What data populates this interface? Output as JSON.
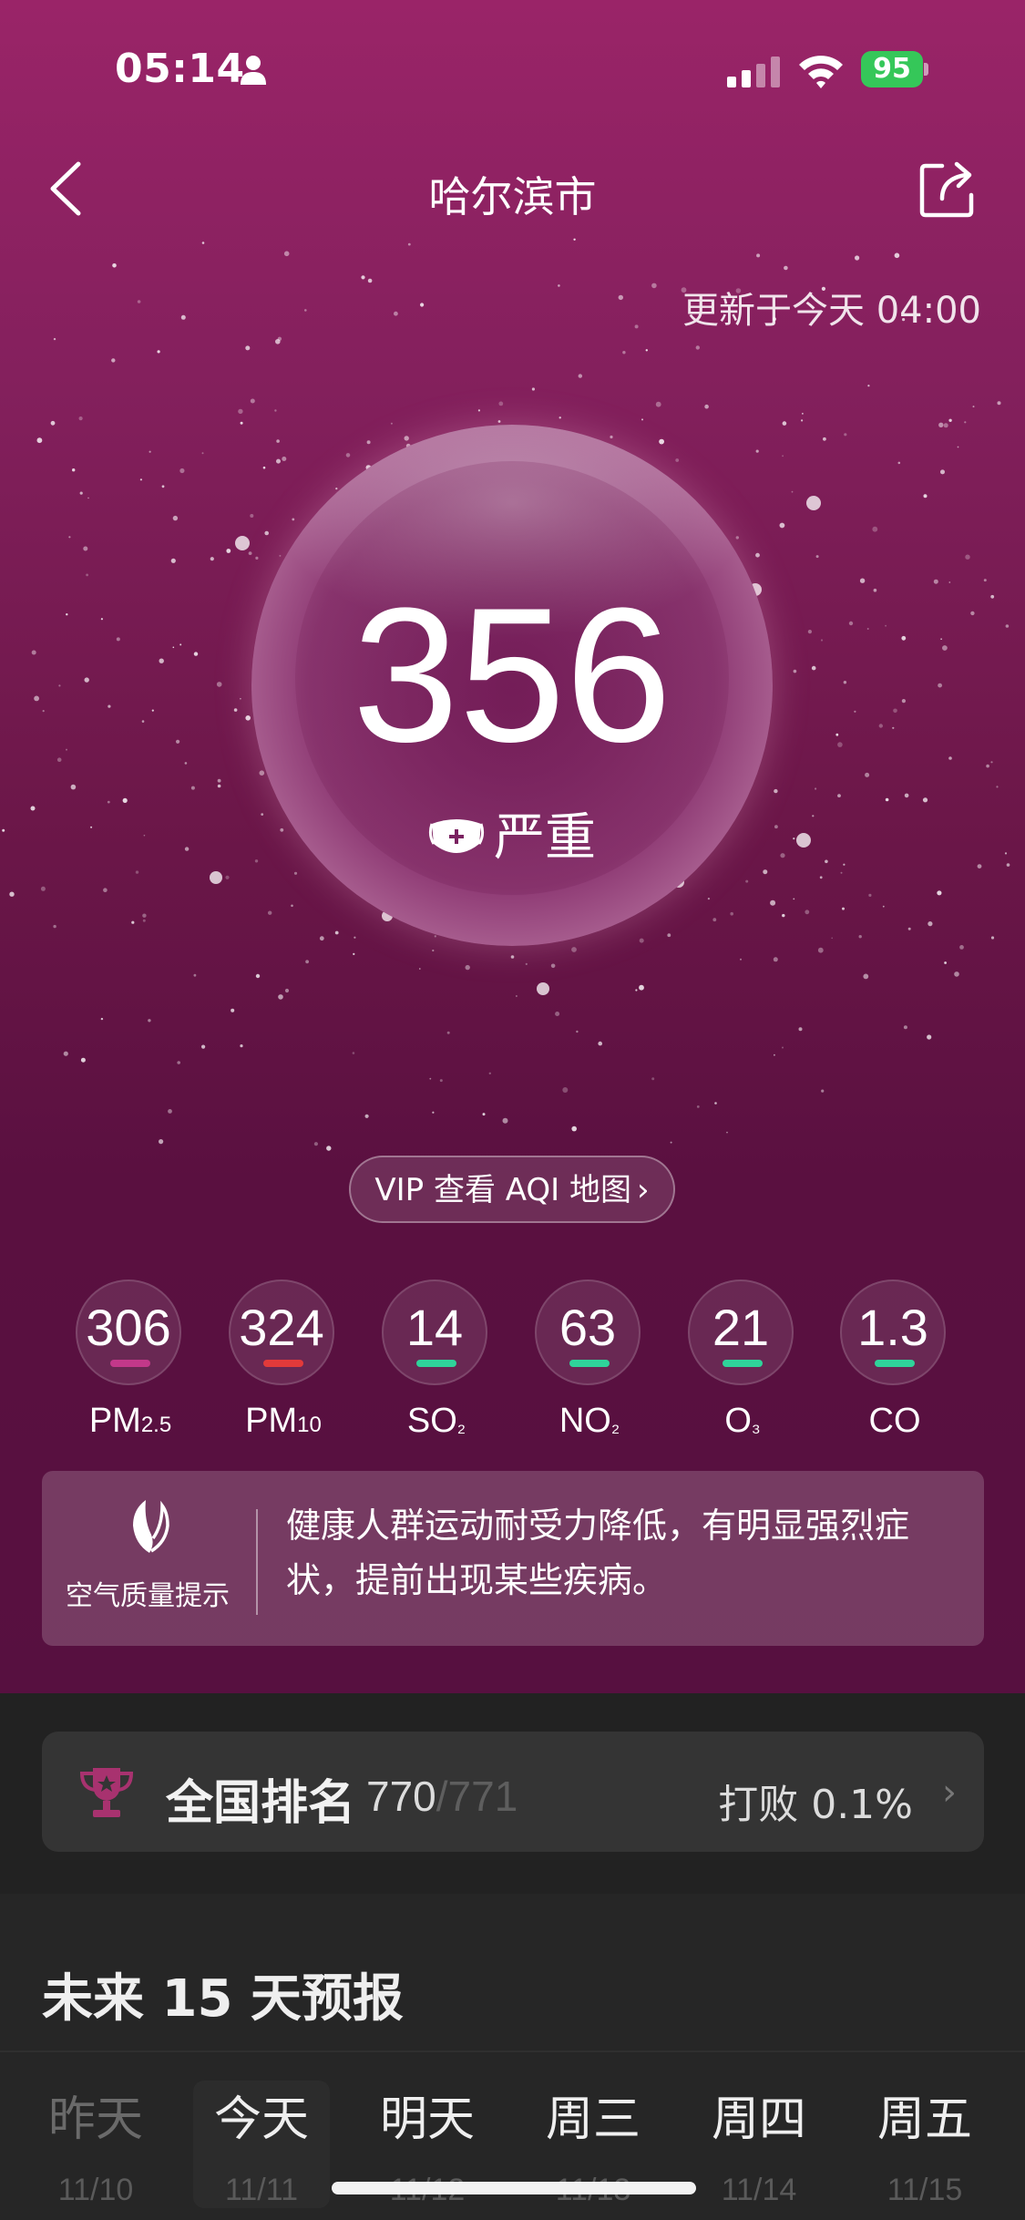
{
  "status_bar": {
    "time": "05:14",
    "battery": "95",
    "icons": [
      "person-icon",
      "signal-icon",
      "wifi-icon",
      "battery-charging-icon"
    ]
  },
  "nav": {
    "title": "哈尔滨市",
    "back_icon": "chevron-left-icon",
    "share_icon": "share-icon"
  },
  "updated": "更新于今天 04:00",
  "aqi": {
    "value": "356",
    "level": "严重",
    "level_icon": "mask-icon"
  },
  "vip_button": {
    "label": "VIP 查看 AQI 地图",
    "chevron": "›"
  },
  "pollutants": [
    {
      "value": "306",
      "name": "PM",
      "sub": "2.5",
      "color": "#c2388a"
    },
    {
      "value": "324",
      "name": "PM",
      "sub": "10",
      "color": "#e23a3a"
    },
    {
      "value": "14",
      "name": "SO",
      "sub": "₂",
      "color": "#2fd39a"
    },
    {
      "value": "63",
      "name": "NO",
      "sub": "₂",
      "color": "#2fd39a"
    },
    {
      "value": "21",
      "name": "O",
      "sub": "₃",
      "color": "#2fd39a"
    },
    {
      "value": "1.3",
      "name": "CO",
      "sub": "",
      "color": "#2fd39a"
    }
  ],
  "tip": {
    "label": "空气质量提示",
    "text": "健康人群运动耐受力降低，有明显强烈症状，提前出现某些疾病。",
    "icon": "leaf-icon"
  },
  "ranking": {
    "label": "全国排名",
    "rank": "770",
    "total": "/771",
    "beat": "打败 0.1%",
    "icon": "trophy-icon",
    "chevron": "›"
  },
  "forecast": {
    "title": "未来 15 天预报",
    "days": [
      {
        "name": "昨天",
        "date": "11/10"
      },
      {
        "name": "今天",
        "date": "11/11"
      },
      {
        "name": "明天",
        "date": "11/12"
      },
      {
        "name": "周三",
        "date": "11/13"
      },
      {
        "name": "周四",
        "date": "11/14"
      },
      {
        "name": "周五",
        "date": "11/15"
      }
    ]
  },
  "colors": {
    "hero_top": "#9a2468",
    "hero_bottom": "#571040",
    "card_dark": "#343434",
    "accent_good": "#2fd39a",
    "accent_bad": "#e23a3a"
  }
}
